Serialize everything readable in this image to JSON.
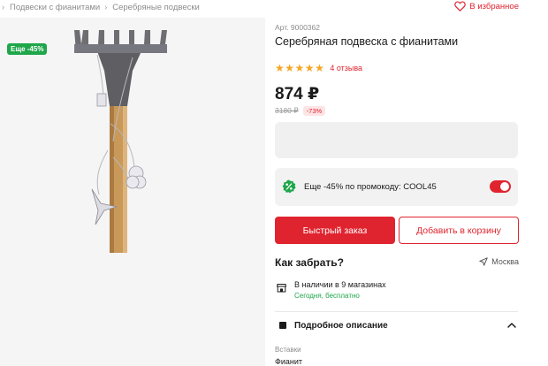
{
  "breadcrumb": [
    {
      "label": "Подвески с фианитами"
    },
    {
      "label": "Серебряные подвески"
    }
  ],
  "favorite": {
    "label": "В избранное",
    "icon": "heart-icon"
  },
  "gallery": {
    "badge": "Еще -45%"
  },
  "product": {
    "article": "Арт. 9000362",
    "title": "Серебряная подвеска с фианитами",
    "rating": 5,
    "reviews": "4 отзыва",
    "price": "874 ₽",
    "old_price": "3180 ₽",
    "discount": "-73%"
  },
  "promo": {
    "icon": "percent-badge-icon",
    "text": "Еще -45% по промокоду: COOL45",
    "enabled": true
  },
  "actions": {
    "quick_order": "Быстрый заказ",
    "add_to_cart": "Добавить в корзину"
  },
  "pickup": {
    "title": "Как забрать?",
    "city": "Москва",
    "stock": "В наличии в 9 магазинах",
    "stock_sub": "Сегодня, бесплатно"
  },
  "details": {
    "title": "Подробное описание",
    "attr_label": "Вставки",
    "attr_value": "Фианит"
  },
  "colors": {
    "accent": "#e0242f",
    "green": "#1fa64a",
    "star": "#f5a623"
  }
}
